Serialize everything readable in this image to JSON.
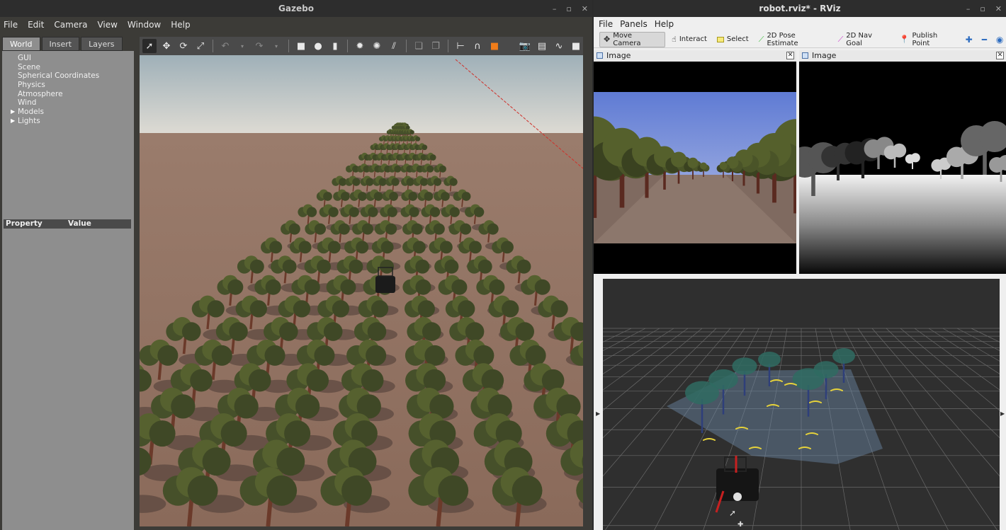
{
  "gazebo": {
    "title": "Gazebo",
    "menu": [
      "File",
      "Edit",
      "Camera",
      "View",
      "Window",
      "Help"
    ],
    "tabs": [
      "World",
      "Insert",
      "Layers"
    ],
    "tree": [
      "GUI",
      "Scene",
      "Spherical Coordinates",
      "Physics",
      "Atmosphere",
      "Wind",
      "Models",
      "Lights"
    ],
    "property_header": {
      "property": "Property",
      "value": "Value"
    }
  },
  "rviz": {
    "title": "robot.rviz* - RViz",
    "menu": [
      "File",
      "Panels",
      "Help"
    ],
    "tools": [
      {
        "label": "Move Camera",
        "icon": "move-camera-icon"
      },
      {
        "label": "Interact",
        "icon": "interact-icon"
      },
      {
        "label": "Select",
        "icon": "select-icon"
      },
      {
        "label": "2D Pose Estimate",
        "icon": "pose-estimate-icon"
      },
      {
        "label": "2D Nav Goal",
        "icon": "nav-goal-icon"
      },
      {
        "label": "Publish Point",
        "icon": "publish-point-icon"
      }
    ],
    "panels": [
      {
        "title": "Image"
      },
      {
        "title": "Image"
      }
    ]
  },
  "colors": {
    "gazebo_bg": "#3c3b37",
    "ground": "#8a6a5a",
    "tree_canopy": "#4f5a2e",
    "trunk": "#6b3a2a",
    "rviz_grid": "#2f2f2f",
    "laser": "#e6d23a"
  }
}
